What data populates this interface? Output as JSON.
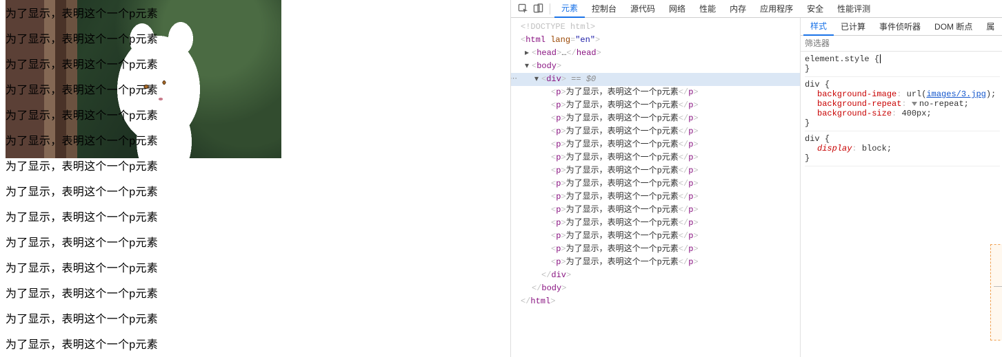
{
  "page": {
    "p_text": "为了显示，表明这个一个p元素",
    "p_count": 14
  },
  "devtools": {
    "tabs": [
      "元素",
      "控制台",
      "源代码",
      "网络",
      "性能",
      "内存",
      "应用程序",
      "安全",
      "性能评测"
    ],
    "active_tab": "元素",
    "dom": {
      "doctype": "<!DOCTYPE html>",
      "html_open": "html",
      "html_lang": "en",
      "head_summary": "<head>…</head>",
      "body": "body",
      "div": "div",
      "eq": "== $0",
      "p_text": "为了显示，表明这个一个p元素",
      "p_count": 14,
      "div_close": "</div>",
      "body_close": "</body>",
      "html_close": "</html>",
      "dots": "…"
    },
    "styles": {
      "tabs": [
        "样式",
        "已计算",
        "事件侦听器",
        "DOM 断点",
        "属"
      ],
      "active": "样式",
      "filter_placeholder": "筛选器",
      "rules": [
        {
          "selector": "element.style",
          "props": []
        },
        {
          "selector": "div",
          "props": [
            {
              "name": "background-image",
              "value_prefix": "url(",
              "value_link": "images/3.jpg",
              "value_suffix": ");"
            },
            {
              "name": "background-repeat",
              "value": "no-repeat;",
              "swatch": true
            },
            {
              "name": "background-size",
              "value": "400px;"
            }
          ]
        },
        {
          "selector": "div",
          "props": [
            {
              "name": "display",
              "italic": true,
              "value": "block;"
            }
          ]
        }
      ]
    }
  }
}
